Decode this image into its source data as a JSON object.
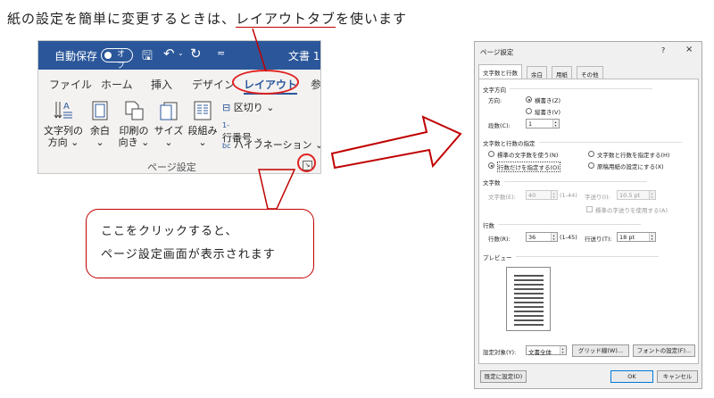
{
  "headline": {
    "prefix": "紙の設定を簡単に変更するときは、",
    "highlight": "レイアウトタブ",
    "suffix": "を使います"
  },
  "ribbon": {
    "autosave_label": "自動保存",
    "autosave_state": "オフ",
    "doc_title": "文書 1",
    "tabs": [
      "ファイル",
      "ホーム",
      "挿入",
      "デザイン",
      "レイアウト",
      "参"
    ],
    "active_tab": "レイアウト",
    "commands": {
      "text_direction": [
        "文字列の",
        "方向"
      ],
      "margins": "余白",
      "orientation": [
        "印刷の",
        "向き"
      ],
      "size": "サイズ",
      "columns": "段組み",
      "breaks": "区切り",
      "line_numbers": "行番号",
      "hyphenation": "ハイフネーション"
    },
    "group_label": "ページ設定"
  },
  "callout": {
    "line1": "ここをクリックすると、",
    "line2": "ページ設定画面が表示されます"
  },
  "dialog": {
    "title": "ページ設定",
    "help": "?",
    "close": "×",
    "tabs": [
      "文字数と行数",
      "余白",
      "用紙",
      "その他"
    ],
    "sections": {
      "direction": "文字方向",
      "grid": "文字数と行数の指定",
      "chars": "文字数",
      "lines": "行数",
      "preview": "プレビュー"
    },
    "direction_label": "方向:",
    "horizontal": "横書き(Z)",
    "vertical": "縦書き(V)",
    "columns_label": "段数(C):",
    "columns_value": "1",
    "grid_options": [
      "標準の文字数を使う(N)",
      "文字数と行数を指定する(H)",
      "行数だけを指定する(O)",
      "原稿用紙の設定にする(X)"
    ],
    "grid_selected": 2,
    "chars_label": "文字数(E):",
    "chars_value": "40",
    "chars_range": "(1-44)",
    "pitch_label": "字送り(I):",
    "pitch_value": "10.5 pt",
    "default_pitch_label": "標準の字送りを使用する(A)",
    "lines_label": "行数(R):",
    "lines_value": "36",
    "lines_range": "(1-45)",
    "line_pitch_label": "行送り(T):",
    "line_pitch_value": "18 pt",
    "apply_label": "設定対象(Y):",
    "apply_value": "文書全体",
    "grid_button": "グリッド線(W)...",
    "font_button": "フォントの設定(F)...",
    "default_button": "既定に設定(D)",
    "ok": "OK",
    "cancel": "キャンセル"
  },
  "colors": {
    "ribbon_blue": "#2b579a",
    "highlight_red": "#e02020"
  }
}
